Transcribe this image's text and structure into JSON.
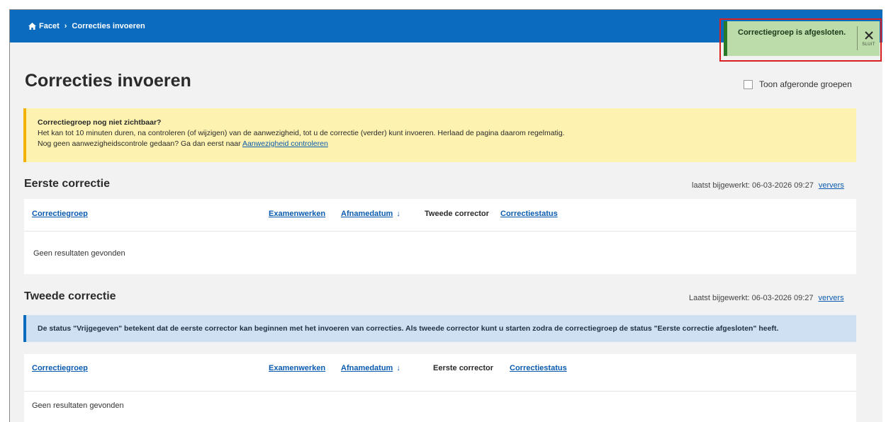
{
  "breadcrumb": {
    "home": "Facet",
    "separator": "›",
    "current": "Correcties invoeren"
  },
  "toast": {
    "message": "Correctiegroep is afgesloten.",
    "close_label": "SLUIT"
  },
  "page": {
    "title": "Correcties invoeren",
    "show_completed_label": "Toon afgeronde groepen"
  },
  "notice": {
    "title": "Correctiegroep nog niet zichtbaar?",
    "line1": "Het kan tot 10 minuten duren, na controleren (of wijzigen) van de aanwezigheid, tot u de correctie (verder) kunt invoeren. Herlaad de pagina daarom regelmatig.",
    "line2_prefix": "Nog geen aanwezigheidscontrole gedaan? Ga dan eerst naar ",
    "line2_link": "Aanwezigheid controleren"
  },
  "first": {
    "title": "Eerste correctie",
    "updated": "laatst bijgewerkt: 06-03-2026 09:27",
    "refresh": "ververs",
    "columns": {
      "group": "Correctiegroep",
      "exams": "Examenwerken",
      "date": "Afnamedatum",
      "sort_icon": "↓",
      "corrector": "Tweede corrector",
      "status": "Correctiestatus"
    },
    "empty": "Geen resultaten gevonden"
  },
  "second": {
    "title": "Tweede correctie",
    "updated": "Laatst bijgewerkt: 06-03-2026 09:27",
    "refresh": "ververs",
    "info": "De status \"Vrijgegeven\" betekent dat de eerste corrector kan beginnen met het invoeren van correcties. Als tweede corrector kunt u starten zodra de correctiegroep de status \"Eerste correctie afgesloten\" heeft.",
    "columns": {
      "group": "Correctiegroep",
      "exams": "Examenwerken",
      "date": "Afnamedatum",
      "sort_icon": "↓",
      "corrector": "Eerste corrector",
      "status": "Correctiestatus"
    },
    "empty": "Geen resultaten gevonden"
  },
  "colors": {
    "header": "#0a6bbf",
    "toast_bg": "#bcdcaa",
    "toast_outline": "#d92020",
    "notice_bg": "#fdf2b0",
    "info_bg": "#cfe0f2",
    "link": "#0a5bb0"
  }
}
